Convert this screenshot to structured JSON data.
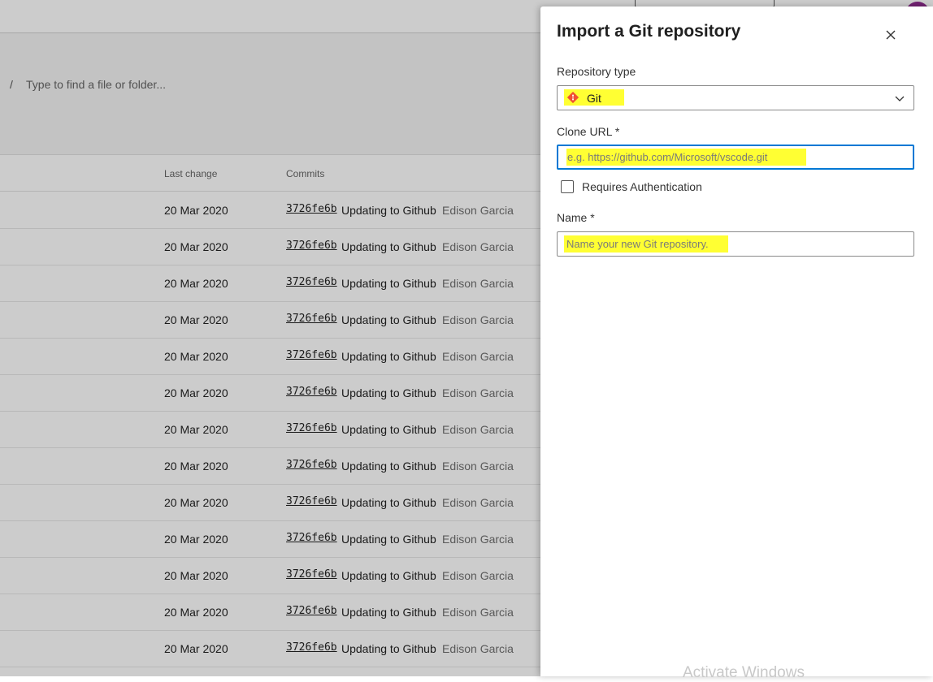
{
  "path_bar": {
    "separator": "/",
    "placeholder": "Type to find a file or folder..."
  },
  "table": {
    "columns": [
      "Last change",
      "Commits"
    ],
    "rows": [
      {
        "date": "20 Mar 2020",
        "hash": "3726fe6b",
        "message": "Updating to Github",
        "author": "Edison Garcia"
      },
      {
        "date": "20 Mar 2020",
        "hash": "3726fe6b",
        "message": "Updating to Github",
        "author": "Edison Garcia"
      },
      {
        "date": "20 Mar 2020",
        "hash": "3726fe6b",
        "message": "Updating to Github",
        "author": "Edison Garcia"
      },
      {
        "date": "20 Mar 2020",
        "hash": "3726fe6b",
        "message": "Updating to Github",
        "author": "Edison Garcia"
      },
      {
        "date": "20 Mar 2020",
        "hash": "3726fe6b",
        "message": "Updating to Github",
        "author": "Edison Garcia"
      },
      {
        "date": "20 Mar 2020",
        "hash": "3726fe6b",
        "message": "Updating to Github",
        "author": "Edison Garcia"
      },
      {
        "date": "20 Mar 2020",
        "hash": "3726fe6b",
        "message": "Updating to Github",
        "author": "Edison Garcia"
      },
      {
        "date": "20 Mar 2020",
        "hash": "3726fe6b",
        "message": "Updating to Github",
        "author": "Edison Garcia"
      },
      {
        "date": "20 Mar 2020",
        "hash": "3726fe6b",
        "message": "Updating to Github",
        "author": "Edison Garcia"
      },
      {
        "date": "20 Mar 2020",
        "hash": "3726fe6b",
        "message": "Updating to Github",
        "author": "Edison Garcia"
      },
      {
        "date": "20 Mar 2020",
        "hash": "3726fe6b",
        "message": "Updating to Github",
        "author": "Edison Garcia"
      },
      {
        "date": "20 Mar 2020",
        "hash": "3726fe6b",
        "message": "Updating to Github",
        "author": "Edison Garcia"
      },
      {
        "date": "20 Mar 2020",
        "hash": "3726fe6b",
        "message": "Updating to Github",
        "author": "Edison Garcia"
      }
    ]
  },
  "dialog": {
    "title": "Import a Git repository",
    "close_icon": "close-icon",
    "repo_type_label": "Repository type",
    "repo_type_value": "Git",
    "repo_type_icon": "git-icon",
    "clone_url_label": "Clone URL *",
    "clone_url_placeholder": "e.g. https://github.com/Microsoft/vscode.git",
    "requires_auth_label": "Requires Authentication",
    "requires_auth_checked": false,
    "name_label": "Name *",
    "name_placeholder": "Name your new Git repository."
  },
  "watermark": "Activate Windows",
  "colors": {
    "highlight": "#ffff33",
    "focus_border": "#0078d4",
    "git_orange": "#f05033",
    "avatar": "#8e2a8e"
  }
}
